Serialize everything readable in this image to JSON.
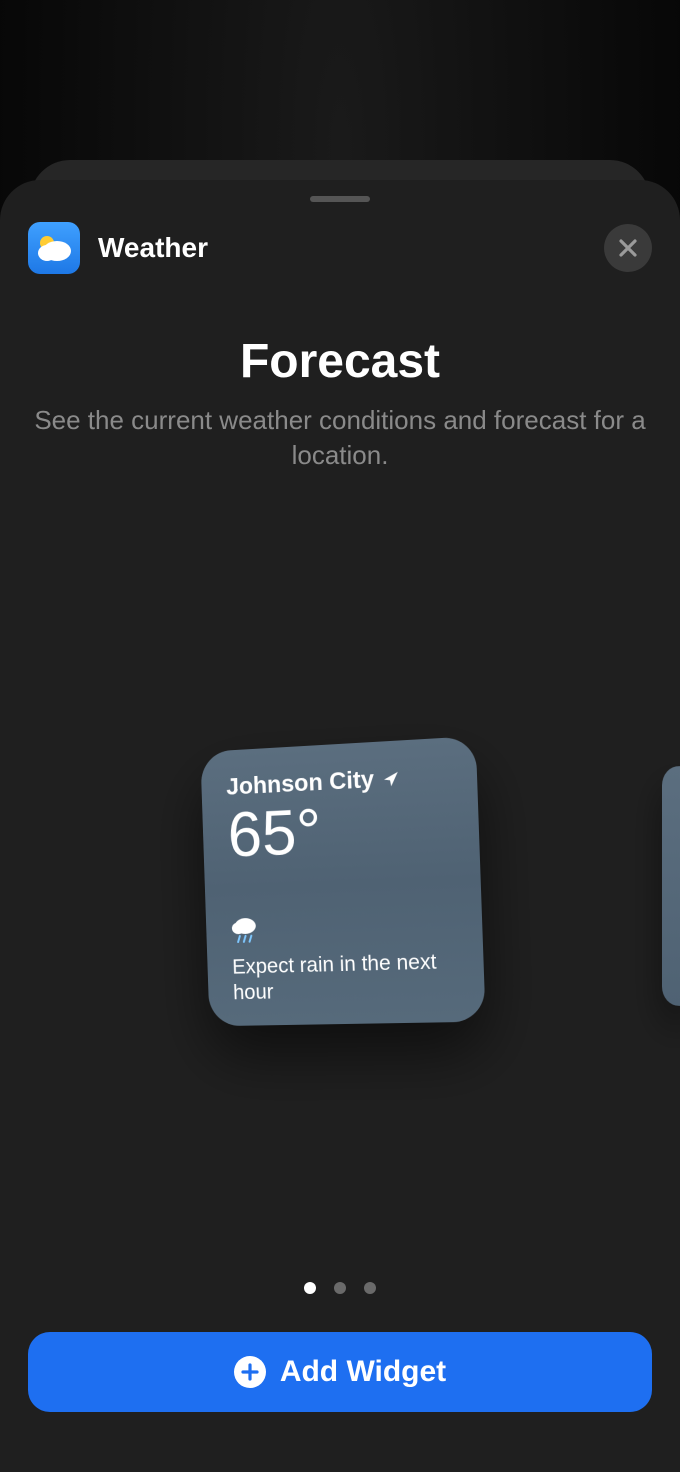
{
  "header": {
    "app_name": "Weather"
  },
  "page": {
    "title": "Forecast",
    "subtitle": "See the current weather conditions and forecast for a location."
  },
  "widget": {
    "location": "Johnson City",
    "temperature": "65°",
    "condition_icon": "rain-icon",
    "forecast_text": "Expect rain in the next hour"
  },
  "pagination": {
    "count": 3,
    "active_index": 0
  },
  "actions": {
    "add_widget_label": "Add Widget"
  }
}
